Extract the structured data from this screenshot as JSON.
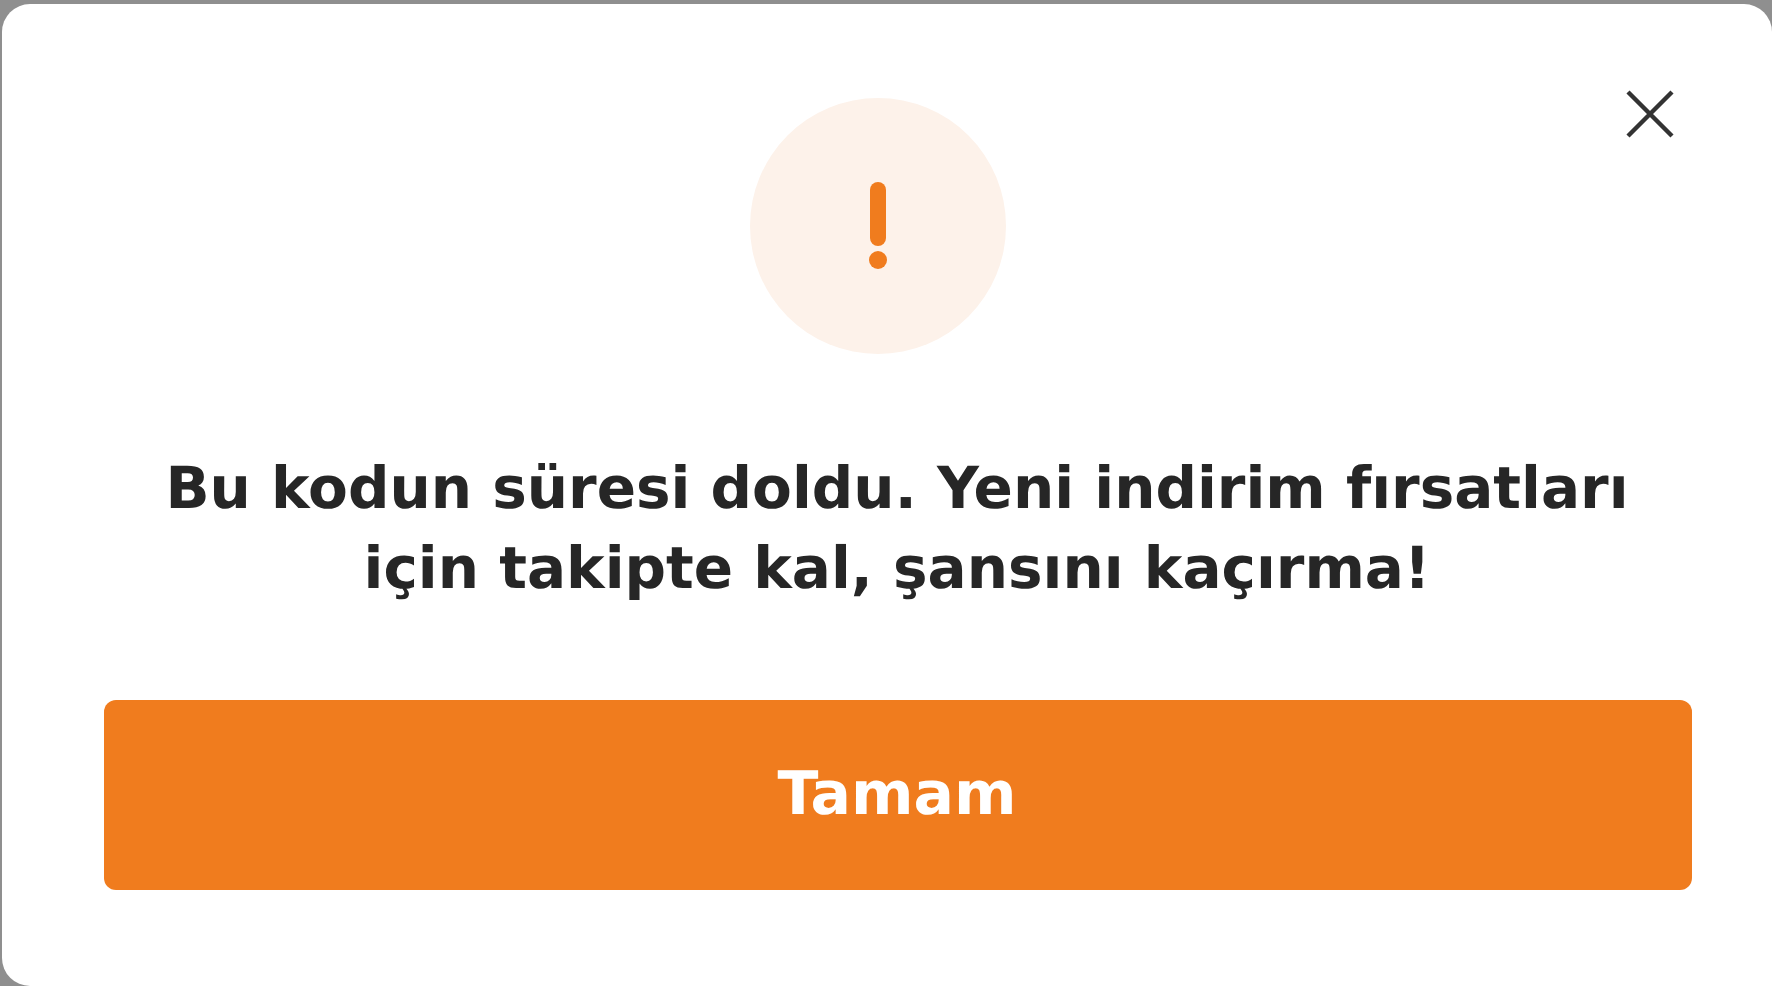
{
  "dialog": {
    "message": "Bu kodun süresi doldu. Yeni indirim fırsatları için takipte kal, şansını kaçırma!",
    "button": "Tamam"
  }
}
